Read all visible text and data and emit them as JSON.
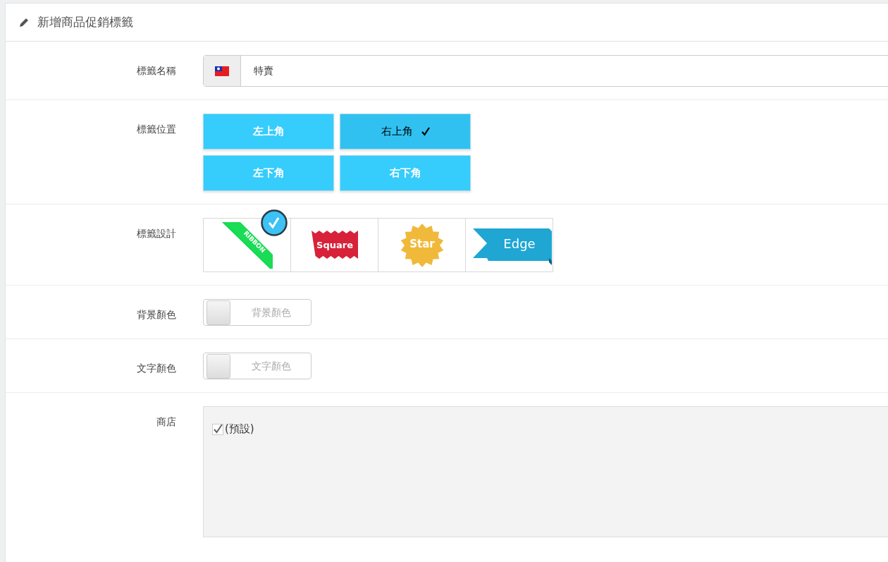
{
  "header": {
    "title": "新增商品促銷標籤"
  },
  "rows": [
    {
      "kind": "text",
      "label": "標籤名稱",
      "value": "特賣"
    },
    {
      "kind": "position",
      "label": "標籤位置",
      "options": [
        {
          "label": "左上角",
          "selected": false
        },
        {
          "label": "右上角",
          "selected": true
        },
        {
          "label": "左下角",
          "selected": false
        },
        {
          "label": "右下角",
          "selected": false
        }
      ]
    },
    {
      "kind": "design",
      "label": "標籤設計",
      "options": [
        {
          "kind": "ribbon",
          "text": "RIBBON",
          "selected": true
        },
        {
          "kind": "square",
          "text": "Square",
          "selected": false
        },
        {
          "kind": "star",
          "text": "Star",
          "selected": false
        },
        {
          "kind": "edge",
          "text": "Edge",
          "selected": false
        }
      ]
    },
    {
      "kind": "color",
      "label": "背景顏色",
      "placeholder": "背景顏色"
    },
    {
      "kind": "color",
      "label": "文字顏色",
      "placeholder": "文字顏色"
    },
    {
      "kind": "stores",
      "label": "商店",
      "stores": [
        {
          "label": "(預設)",
          "checked": true
        }
      ]
    }
  ]
}
